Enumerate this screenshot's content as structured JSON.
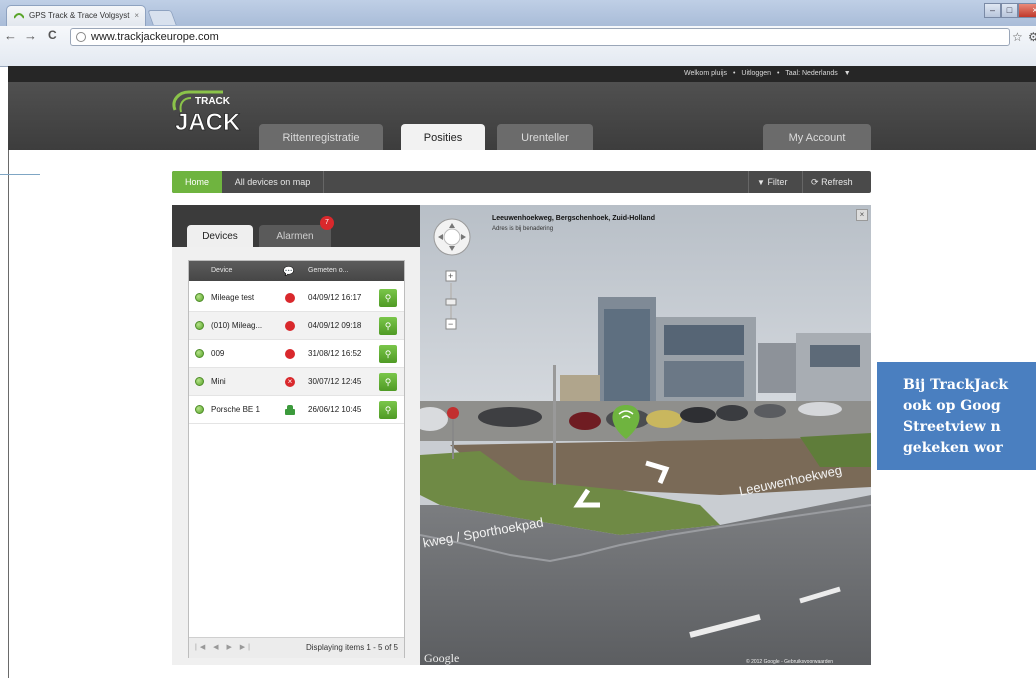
{
  "browser": {
    "tab_title": "GPS Track & Trace Volgsyst",
    "tab_close": "×",
    "url": "www.trackjackeurope.com",
    "nav_back": "←",
    "nav_forward": "→",
    "nav_reload": "C"
  },
  "topbar": {
    "welcome": "Welkom pluijs",
    "sep1": "•",
    "logout": "Uitloggen",
    "sep2": "•",
    "language": "Taal: Nederlands",
    "lang_arrow": "▼"
  },
  "logo": {
    "line1": "TRACK",
    "line2": "JACK"
  },
  "nav": {
    "tabs": [
      {
        "label": "Rittenregistratie",
        "active": false
      },
      {
        "label": "Posities",
        "active": true
      },
      {
        "label": "Urenteller",
        "active": false
      }
    ],
    "account": "My Account"
  },
  "toolbar": {
    "home": "Home",
    "all_devices": "All devices on map",
    "filter": "Filter",
    "refresh": "Refresh"
  },
  "panel": {
    "tabs": {
      "devices": "Devices",
      "alarmen": "Alarmen"
    },
    "alarm_count": "7",
    "columns": {
      "device": "Device",
      "measured": "Gemeten o..."
    },
    "rows": [
      {
        "device": "Mileage test",
        "status": "stop",
        "date": "04/09/12 16:17"
      },
      {
        "device": "(010) Mileag...",
        "status": "stop",
        "date": "04/09/12 09:18"
      },
      {
        "device": "009",
        "status": "stop",
        "date": "31/08/12 16:52"
      },
      {
        "device": "Mini",
        "status": "error",
        "date": "30/07/12 12:45"
      },
      {
        "device": "Porsche BE 1",
        "status": "car",
        "date": "26/06/12 10:45"
      }
    ],
    "pager_info": "Displaying items 1 - 5 of 5"
  },
  "streetview": {
    "address": "Leeuwenhoekweg, Bergschenhoek, Zuid-Holland",
    "approx": "Adres is bij benadering",
    "street1": "Leeuwenhoekweg",
    "street2": "kweg / Sporthoekpad",
    "google": "Google",
    "copyright": "© 2012 Google - Gebruiksvoorwaarden"
  },
  "callout": {
    "lines": [
      "Bij TrackJack",
      "ook op Goog",
      "Streetview n",
      "gekeken wor"
    ]
  },
  "colors": {
    "accent_green": "#6fb43f",
    "callout_blue": "#4a7fc0",
    "header_dark": "#3d3d3d",
    "alarm_red": "#d9282c"
  }
}
